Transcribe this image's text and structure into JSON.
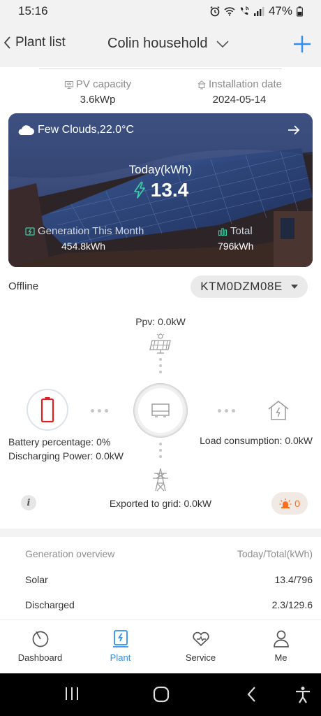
{
  "status_bar": {
    "time": "15:16",
    "battery": "47%"
  },
  "header": {
    "back_label": "Plant list",
    "plant_name": "Colin household"
  },
  "info": {
    "pv_capacity_label": "PV capacity",
    "pv_capacity_value": "3.6kWp",
    "install_date_label": "Installation date",
    "install_date_value": "2024-05-14"
  },
  "solar_card": {
    "weather": "Few Clouds,22.0°C",
    "today_label": "Today(kWh)",
    "today_value": "13.4",
    "month_label": "Generation This Month",
    "month_value": "454.8kWh",
    "total_label": "Total",
    "total_value": "796kWh"
  },
  "device": {
    "status": "Offline",
    "serial": "KTM0DZM08E"
  },
  "flow": {
    "ppv": "Ppv: 0.0kW",
    "battery_percentage": "Battery percentage: 0%",
    "discharging_power": "Discharging Power: 0.0kW",
    "load_consumption": "Load consumption: 0.0kW",
    "exported_grid": "Exported to grid: 0.0kW",
    "alarm_count": "0",
    "info_glyph": "i"
  },
  "overview": {
    "title": "Generation overview",
    "unit": "Today/Total(kWh)",
    "rows": [
      {
        "label": "Solar",
        "value": "13.4/796"
      },
      {
        "label": "Discharged",
        "value": "2.3/129.6"
      }
    ]
  },
  "nav": {
    "items": [
      {
        "label": "Dashboard",
        "icon": "dashboard-icon"
      },
      {
        "label": "Plant",
        "icon": "plant-icon"
      },
      {
        "label": "Service",
        "icon": "service-icon"
      },
      {
        "label": "Me",
        "icon": "me-icon"
      }
    ],
    "active": "Plant"
  },
  "colors": {
    "accent": "#2f8ff0",
    "alarm": "#ff6d1f",
    "battery_red": "#e02020",
    "icon_gray": "#9a9a9a"
  }
}
